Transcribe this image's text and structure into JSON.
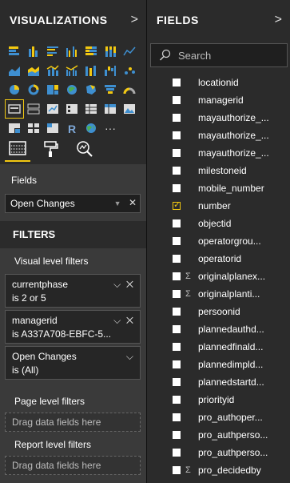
{
  "viz": {
    "title": "VISUALIZATIONS",
    "fields_label": "Fields",
    "field_value": "Open Changes",
    "filters_title": "FILTERS",
    "visual_level": "Visual level filters",
    "page_level": "Page level filters",
    "report_level": "Report level filters",
    "drop_text": "Drag data fields here",
    "filters": [
      {
        "field": "currentphase",
        "cond": "is 2 or 5"
      },
      {
        "field": "managerid",
        "cond": "is A337A708-EBFC-5..."
      },
      {
        "field": "Open Changes",
        "cond": "is (All)"
      }
    ]
  },
  "fields": {
    "title": "FIELDS",
    "search_placeholder": "Search",
    "items": [
      {
        "name": "locationid",
        "checked": false,
        "sigma": false
      },
      {
        "name": "managerid",
        "checked": false,
        "sigma": false
      },
      {
        "name": "mayauthorize_...",
        "checked": false,
        "sigma": false
      },
      {
        "name": "mayauthorize_...",
        "checked": false,
        "sigma": false
      },
      {
        "name": "mayauthorize_...",
        "checked": false,
        "sigma": false
      },
      {
        "name": "milestoneid",
        "checked": false,
        "sigma": false
      },
      {
        "name": "mobile_number",
        "checked": false,
        "sigma": false
      },
      {
        "name": "number",
        "checked": true,
        "sigma": false
      },
      {
        "name": "objectid",
        "checked": false,
        "sigma": false
      },
      {
        "name": "operatorgrou...",
        "checked": false,
        "sigma": false
      },
      {
        "name": "operatorid",
        "checked": false,
        "sigma": false
      },
      {
        "name": "originalplanex...",
        "checked": false,
        "sigma": true
      },
      {
        "name": "originalplanti...",
        "checked": false,
        "sigma": true
      },
      {
        "name": "persoonid",
        "checked": false,
        "sigma": false
      },
      {
        "name": "plannedauthd...",
        "checked": false,
        "sigma": false
      },
      {
        "name": "plannedfinald...",
        "checked": false,
        "sigma": false
      },
      {
        "name": "plannedimpld...",
        "checked": false,
        "sigma": false
      },
      {
        "name": "plannedstartd...",
        "checked": false,
        "sigma": false
      },
      {
        "name": "priorityid",
        "checked": false,
        "sigma": false
      },
      {
        "name": "pro_authoper...",
        "checked": false,
        "sigma": false
      },
      {
        "name": "pro_authperso...",
        "checked": false,
        "sigma": false
      },
      {
        "name": "pro_authperso...",
        "checked": false,
        "sigma": false
      },
      {
        "name": "pro_decidedby",
        "checked": false,
        "sigma": true
      }
    ]
  },
  "colors": {
    "accent": "#f2c811",
    "panel": "#2b2b2b",
    "well": "#1f1f1f"
  }
}
